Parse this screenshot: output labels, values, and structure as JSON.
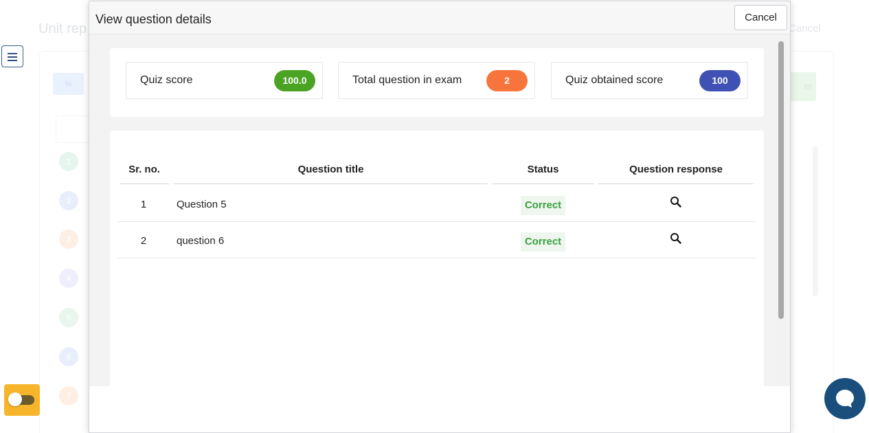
{
  "background": {
    "title": "Unit rep",
    "cancel_label": "Cancel",
    "percent_label": "%",
    "green_button_label": "er",
    "row_numbers": [
      "1",
      "2",
      "3",
      "4",
      "5",
      "6",
      "7"
    ],
    "row_colors": [
      "#e6f6ef",
      "#e8eefc",
      "#fdefe3",
      "#efeefc",
      "#e8f6ee",
      "#e8eefc",
      "#fdefe3"
    ]
  },
  "modal": {
    "title": "View question details",
    "cancel_label": "Cancel",
    "summary": [
      {
        "label": "Quiz score",
        "value": "100.0",
        "color": "#4aa323"
      },
      {
        "label": "Total question in exam",
        "value": "2",
        "color": "#f7753d"
      },
      {
        "label": "Quiz obtained score",
        "value": "100",
        "color": "#3f51b5"
      }
    ],
    "table": {
      "headers": [
        "Sr. no.",
        "Question title",
        "Status",
        "Question response"
      ],
      "rows": [
        {
          "sr": "1",
          "title": "Question 5",
          "status": "Correct",
          "icon": "search-icon"
        },
        {
          "sr": "2",
          "title": "question 6",
          "status": "Correct",
          "icon": "search-icon"
        }
      ]
    }
  },
  "colors": {
    "status_correct": "#3aa240",
    "chat_button": "#1a4f7d",
    "toggle": "#f7b52c"
  },
  "icons": {
    "menu": "hamburger-menu-icon",
    "chat": "chat-bubble-icon",
    "response": "search-icon"
  }
}
